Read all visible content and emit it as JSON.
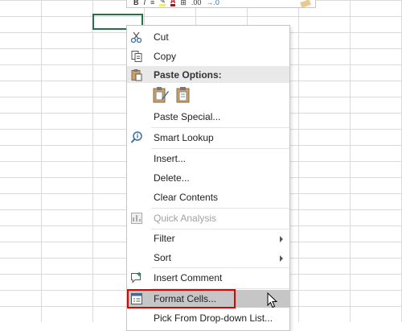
{
  "menu": {
    "cut": "Cut",
    "copy": "Copy",
    "paste_options": "Paste Options:",
    "paste_special": "Paste Special...",
    "smart_lookup": "Smart Lookup",
    "insert": "Insert...",
    "delete": "Delete...",
    "clear_contents": "Clear Contents",
    "quick_analysis": "Quick Analysis",
    "filter": "Filter",
    "sort": "Sort",
    "insert_comment": "Insert Comment",
    "format_cells": "Format Cells...",
    "pick_list": "Pick From Drop-down List..."
  },
  "mini_toolbar": {
    "bold": "B",
    "italic": "I",
    "decimal_increase": ".00",
    "decimal_decrease": "→.0"
  },
  "colors": {
    "selection": "#217346",
    "highlight_border": "#e00000",
    "hover_bg": "#c6c6c6",
    "font_color": "#c00000"
  }
}
